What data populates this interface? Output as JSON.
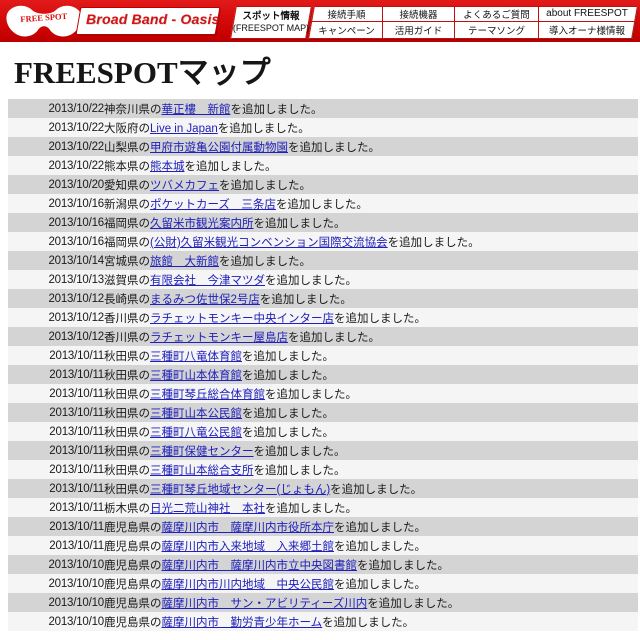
{
  "header": {
    "logo_text": "FREE SPOT",
    "banner_text": "Broad Band - Oasis",
    "spot_info": {
      "line1": "スポット情報",
      "line2": "(FREESPOT MAP)"
    },
    "nav": [
      {
        "label": "接続手順",
        "row": 1
      },
      {
        "label": "接続機器",
        "row": 1
      },
      {
        "label": "よくあるご質問",
        "row": 1
      },
      {
        "label": "about FREESPOT",
        "row": 1
      },
      {
        "label": "キャンペーン",
        "row": 2
      },
      {
        "label": "活用ガイド",
        "row": 2
      },
      {
        "label": "テーマソング",
        "row": 2
      },
      {
        "label": "導入オーナ様情報",
        "row": 2
      }
    ],
    "colors": {
      "bar_red": "#d70d0d",
      "border_red": "#bf1010",
      "banner_text_red": "#d81111"
    }
  },
  "page_title": "FREESPOTマップ",
  "table": {
    "row_colors": {
      "odd": "#d4d4d4",
      "even": "#f5f5f5"
    },
    "link_color": "#2020bb",
    "rows": [
      {
        "date": "2013/10/22",
        "prefix": "神奈川県の",
        "link": "華正樓　新館",
        "suffix": "を追加しました。"
      },
      {
        "date": "2013/10/22",
        "prefix": "大阪府の",
        "link": "Live in Japan",
        "suffix": "を追加しました。"
      },
      {
        "date": "2013/10/22",
        "prefix": "山梨県の",
        "link": "甲府市遊亀公園付属動物園",
        "suffix": "を追加しました。"
      },
      {
        "date": "2013/10/22",
        "prefix": "熊本県の",
        "link": "熊本城",
        "suffix": "を追加しました。"
      },
      {
        "date": "2013/10/20",
        "prefix": "愛知県の",
        "link": "ツバメカフェ",
        "suffix": "を追加しました。"
      },
      {
        "date": "2013/10/16",
        "prefix": "新潟県の",
        "link": "ポケットカーズ　三条店",
        "suffix": "を追加しました。"
      },
      {
        "date": "2013/10/16",
        "prefix": "福岡県の",
        "link": "久留米市観光案内所",
        "suffix": "を追加しました。"
      },
      {
        "date": "2013/10/16",
        "prefix": "福岡県の",
        "link": "(公財)久留米観光コンベンション国際交流協会",
        "suffix": "を追加しました。"
      },
      {
        "date": "2013/10/14",
        "prefix": "宮城県の",
        "link": "旅館　大新館",
        "suffix": "を追加しました。"
      },
      {
        "date": "2013/10/13",
        "prefix": "滋賀県の",
        "link": "有限会社　今津マツダ",
        "suffix": "を追加しました。"
      },
      {
        "date": "2013/10/12",
        "prefix": "長崎県の",
        "link": "まるみつ佐世保2号店",
        "suffix": "を追加しました。"
      },
      {
        "date": "2013/10/12",
        "prefix": "香川県の",
        "link": "ラチェットモンキー中央インター店",
        "suffix": "を追加しました。"
      },
      {
        "date": "2013/10/12",
        "prefix": "香川県の",
        "link": "ラチェットモンキー屋島店",
        "suffix": "を追加しました。"
      },
      {
        "date": "2013/10/11",
        "prefix": "秋田県の",
        "link": "三種町八竜体育館",
        "suffix": "を追加しました。"
      },
      {
        "date": "2013/10/11",
        "prefix": "秋田県の",
        "link": "三種町山本体育館",
        "suffix": "を追加しました。"
      },
      {
        "date": "2013/10/11",
        "prefix": "秋田県の",
        "link": "三種町琴丘総合体育館",
        "suffix": "を追加しました。"
      },
      {
        "date": "2013/10/11",
        "prefix": "秋田県の",
        "link": "三種町山本公民館",
        "suffix": "を追加しました。"
      },
      {
        "date": "2013/10/11",
        "prefix": "秋田県の",
        "link": "三種町八竜公民館",
        "suffix": "を追加しました。"
      },
      {
        "date": "2013/10/11",
        "prefix": "秋田県の",
        "link": "三種町保健センター",
        "suffix": "を追加しました。"
      },
      {
        "date": "2013/10/11",
        "prefix": "秋田県の",
        "link": "三種町山本総合支所",
        "suffix": "を追加しました。"
      },
      {
        "date": "2013/10/11",
        "prefix": "秋田県の",
        "link": "三種町琴丘地域センター(じょもん)",
        "suffix": "を追加しました。"
      },
      {
        "date": "2013/10/11",
        "prefix": "栃木県の",
        "link": "日光二荒山神社　本社",
        "suffix": "を追加しました。"
      },
      {
        "date": "2013/10/11",
        "prefix": "鹿児島県の",
        "link": "薩摩川内市　薩摩川内市役所本庁",
        "suffix": "を追加しました。"
      },
      {
        "date": "2013/10/11",
        "prefix": "鹿児島県の",
        "link": "薩摩川内市入来地域　入来郷土館",
        "suffix": "を追加しました。"
      },
      {
        "date": "2013/10/10",
        "prefix": "鹿児島県の",
        "link": "薩摩川内市　薩摩川内市立中央図書館",
        "suffix": "を追加しました。"
      },
      {
        "date": "2013/10/10",
        "prefix": "鹿児島県の",
        "link": "薩摩川内市川内地域　中央公民館",
        "suffix": "を追加しました。"
      },
      {
        "date": "2013/10/10",
        "prefix": "鹿児島県の",
        "link": "薩摩川内市　サン・アビリティーズ川内",
        "suffix": "を追加しました。"
      },
      {
        "date": "2013/10/10",
        "prefix": "鹿児島県の",
        "link": "薩摩川内市　勤労青少年ホーム",
        "suffix": "を追加しました。"
      }
    ]
  }
}
